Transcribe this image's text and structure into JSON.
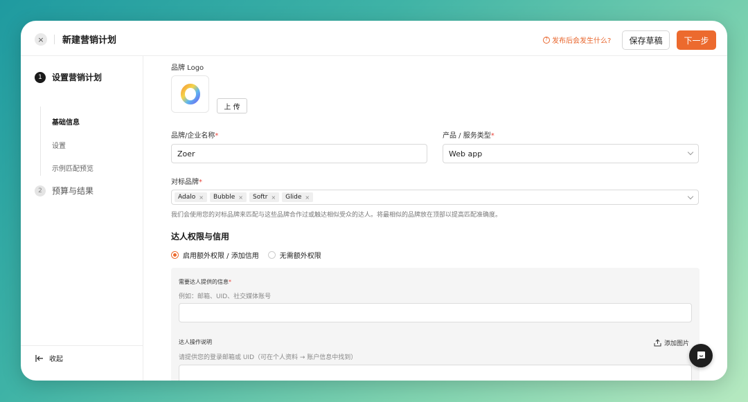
{
  "header": {
    "close_icon": "×",
    "title": "新建营销计划",
    "help_link": "发布后会发生什么?",
    "save_draft": "保存草稿",
    "next": "下一步"
  },
  "sidebar": {
    "steps": [
      {
        "num": "1",
        "label": "设置营销计划",
        "active": true
      },
      {
        "num": "2",
        "label": "预算与结果",
        "active": false
      }
    ],
    "sub_items": [
      {
        "label": "基础信息",
        "active": true
      },
      {
        "label": "设置",
        "active": false
      },
      {
        "label": "示例匹配预览",
        "active": false
      }
    ],
    "collapse": "收起"
  },
  "form": {
    "logo_label": "品牌 Logo",
    "upload": "上 传",
    "brand_name_label": "品牌/企业名称",
    "brand_name_value": "Zoer",
    "product_type_label": "产品 / 服务类型",
    "product_type_value": "Web app",
    "competitors_label": "对标品牌",
    "competitors": [
      "Adalo",
      "Bubble",
      "Softr",
      "Glide"
    ],
    "competitors_help": "我们会使用您的对标品牌来匹配与这些品牌合作过或触达相似受众的达人。将最相似的品牌放在顶部以提高匹配准确度。",
    "section_title": "达人权限与信用",
    "radio_options": [
      {
        "label": "启用额外权限 / 添加信用",
        "checked": true
      },
      {
        "label": "无需额外权限",
        "checked": false
      }
    ],
    "required_info_label": "需要达人提供的信息",
    "required_info_placeholder": "例如：邮箱、UID、社交媒体账号",
    "instructions_label": "达人操作说明",
    "add_image": "添加图片",
    "instructions_placeholder": "请提供您的登录邮箱或 UID（可在个人资料 → 账户信息中找到）"
  },
  "colors": {
    "accent": "#ec6a2e",
    "required": "#e8443a"
  }
}
